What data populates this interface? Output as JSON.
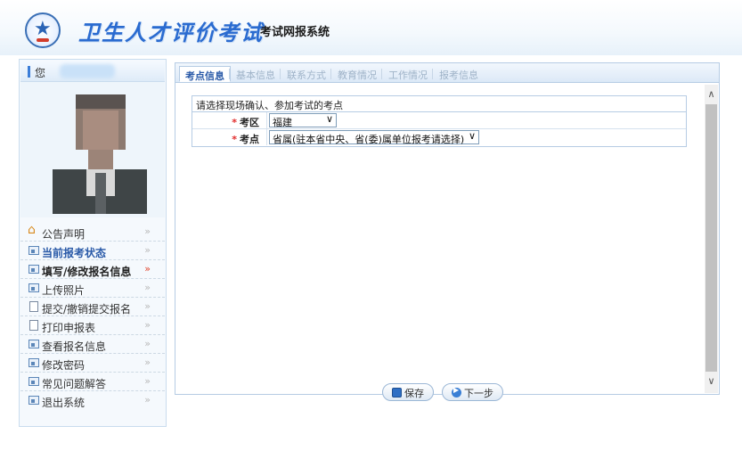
{
  "header": {
    "title": "卫生人才评价考试",
    "subtitle": "考试网报系统"
  },
  "user": {
    "greeting": "您"
  },
  "menu": [
    {
      "label": "公告声明",
      "icon": "home-icon",
      "active": false,
      "bold": false
    },
    {
      "label": "当前报考状态",
      "icon": "card-icon",
      "active": false,
      "bold": true
    },
    {
      "label": "填写/修改报名信息",
      "icon": "card-icon",
      "active": true,
      "bold": true
    },
    {
      "label": "上传照片",
      "icon": "card-icon",
      "active": false,
      "bold": false
    },
    {
      "label": "提交/撤销提交报名",
      "icon": "doc-icon",
      "active": false,
      "bold": false
    },
    {
      "label": "打印申报表",
      "icon": "doc-icon",
      "active": false,
      "bold": false
    },
    {
      "label": "查看报名信息",
      "icon": "card-icon",
      "active": false,
      "bold": false
    },
    {
      "label": "修改密码",
      "icon": "card-icon",
      "active": false,
      "bold": false
    },
    {
      "label": "常见问题解答",
      "icon": "card-icon",
      "active": false,
      "bold": false
    },
    {
      "label": "退出系统",
      "icon": "card-icon",
      "active": false,
      "bold": false
    }
  ],
  "tabs": [
    {
      "label": "考点信息",
      "active": true
    },
    {
      "label": "基本信息",
      "active": false
    },
    {
      "label": "联系方式",
      "active": false
    },
    {
      "label": "教育情况",
      "active": false
    },
    {
      "label": "工作情况",
      "active": false
    },
    {
      "label": "报考信息",
      "active": false
    }
  ],
  "form": {
    "instruction": "请选择现场确认、参加考试的考点",
    "fields": [
      {
        "label": "考区",
        "value": "福建",
        "required_mark": "*"
      },
      {
        "label": "考点",
        "value": "省属(驻本省中央、省(委)属单位报考请选择)",
        "required_mark": "*"
      }
    ]
  },
  "buttons": {
    "save": "保存",
    "next": "下一步"
  },
  "colors": {
    "accent": "#2a6bd0",
    "required": "#e12b2b",
    "border": "#b6cce4"
  }
}
